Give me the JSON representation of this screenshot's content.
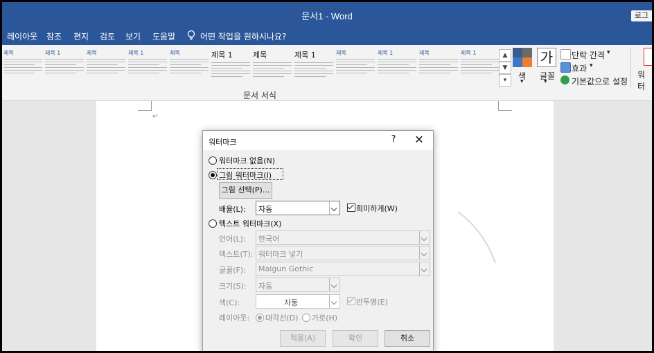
{
  "window": {
    "title": "문서1  -  Word",
    "login_button": "로그"
  },
  "menu": {
    "tabs": [
      "레이아웃",
      "참조",
      "편지",
      "검토",
      "보기",
      "도움말"
    ],
    "tell_me": "어떤 작업을 원하시나요?"
  },
  "ribbon": {
    "style_thumb_title": "제목",
    "style_thumb_title_small": "제목 1",
    "group_label": "문서 서식",
    "colors_label": "색",
    "fonts_label": "글꼴",
    "fonts_glyph": "가",
    "paragraph_spacing": "단락 간격",
    "effects": "효과",
    "set_as_default": "기본값으로 설정",
    "watermark_partial": "워터"
  },
  "dialog": {
    "title": "워터마크",
    "help": "?",
    "close": "✕",
    "no_watermark": "워터마크 없음(N)",
    "picture_watermark": "그림 워터마크(I)",
    "select_picture": "그림 선택(P)...",
    "scale_label": "배율(L):",
    "scale_value": "자동",
    "washout": "희미하게(W)",
    "text_watermark": "텍스트 워터마크(X)",
    "language_label": "언어(L):",
    "language_value": "한국어",
    "text_label": "텍스트(T):",
    "text_value": "워터마크 넣기",
    "font_label": "글꼴(F):",
    "font_value": "Malgun Gothic",
    "size_label": "크기(S):",
    "size_value": "자동",
    "color_label": "색(C):",
    "color_value": "자동",
    "semitransparent": "반투명(E)",
    "layout_label": "레이아웃:",
    "diagonal": "대각선(D)",
    "horizontal": "가로(H)",
    "apply": "적용(A)",
    "ok": "확인",
    "cancel": "취소"
  },
  "document": {
    "paragraph_mark": "↵"
  },
  "colors": {
    "accent": "#2b579a"
  }
}
